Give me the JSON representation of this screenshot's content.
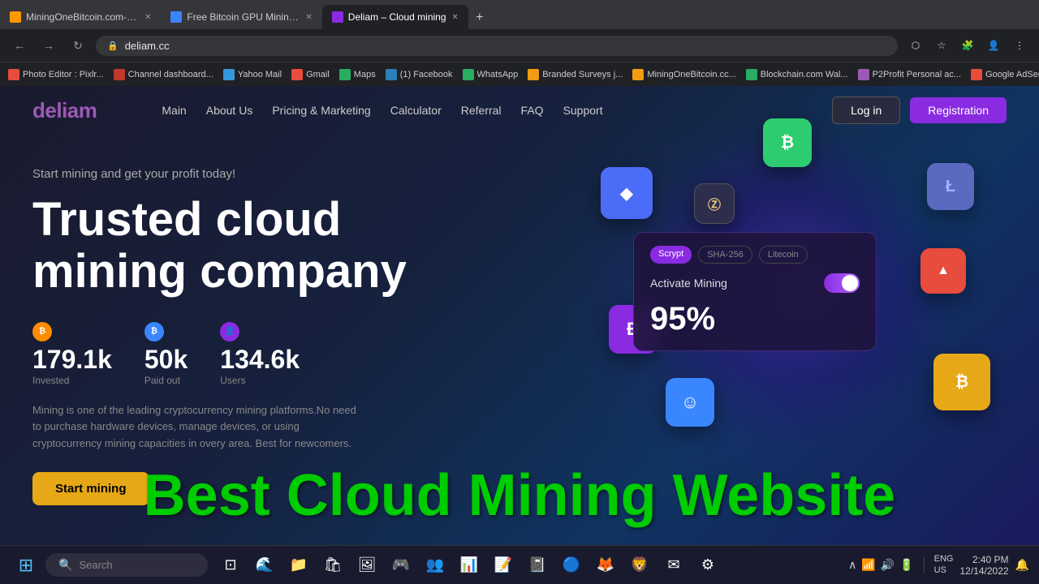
{
  "browser": {
    "tabs": [
      {
        "id": "tab1",
        "favicon_color": "#f90",
        "title": "MiningOneBitcoin.com-Mining...",
        "active": false
      },
      {
        "id": "tab2",
        "favicon_color": "#3a86ff",
        "title": "Free Bitcoin GPU Mining, Cloud...",
        "active": false
      },
      {
        "id": "tab3",
        "favicon_color": "#8a2be2",
        "title": "Deliam – Cloud mining",
        "active": true
      }
    ],
    "url": "deliam.cc",
    "bookmarks": [
      {
        "label": "Photo Editor : Pixlr..."
      },
      {
        "label": "Channel dashboard..."
      },
      {
        "label": "Yahoo Mail"
      },
      {
        "label": "Gmail"
      },
      {
        "label": "Maps"
      },
      {
        "label": "(1) Facebook"
      },
      {
        "label": "WhatsApp"
      },
      {
        "label": "Branded Surveys j..."
      },
      {
        "label": "MiningOneBitcoin.cc..."
      },
      {
        "label": "Blockchain.com Wal..."
      },
      {
        "label": "P2Profit Personal ac..."
      },
      {
        "label": "Google AdSense"
      }
    ]
  },
  "nav": {
    "logo": "deliam",
    "links": [
      {
        "label": "Main"
      },
      {
        "label": "About Us"
      },
      {
        "label": "Pricing & Marketing"
      },
      {
        "label": "Calculator"
      },
      {
        "label": "Referral"
      },
      {
        "label": "FAQ"
      },
      {
        "label": "Support"
      }
    ],
    "login_label": "Log in",
    "register_label": "Registration"
  },
  "hero": {
    "tagline": "Start mining and get your profit today!",
    "title_line1": "Trusted cloud",
    "title_line2": "mining company",
    "stats": [
      {
        "icon_color": "#ff8c00",
        "value": "179.1k",
        "label": "Invested"
      },
      {
        "icon_color": "#3a86ff",
        "value": "50k",
        "label": "Paid out"
      },
      {
        "icon_color": "#8a2be2",
        "value": "134.6k",
        "label": "Users"
      }
    ],
    "description": "Mining is one of the leading cryptocurrency mining platforms.No need to purchase hardware devices, manage devices, or using cryptocurrency mining capacities in overy area. Best for newcomers.",
    "cta_label": "Start mining"
  },
  "mining_card": {
    "tabs": [
      "Scrypt",
      "SHA-256",
      "Litecoin"
    ],
    "active_tab": "Scrypt",
    "activate_label": "Activate Mining",
    "percentage": "95%"
  },
  "crypto_icons": {
    "eth": "◆",
    "btc": "₿",
    "ltc": "Ł",
    "zec": "ⓩ",
    "trx": "▲",
    "dog": "Ð",
    "btc2": "₿",
    "smiley": "☺"
  },
  "overlay": {
    "text": "Best Cloud Mining Website"
  },
  "taskbar": {
    "search_placeholder": "Search",
    "language": "ENG\nUS",
    "time": "2:40 PM",
    "date": "12/14/2022"
  }
}
